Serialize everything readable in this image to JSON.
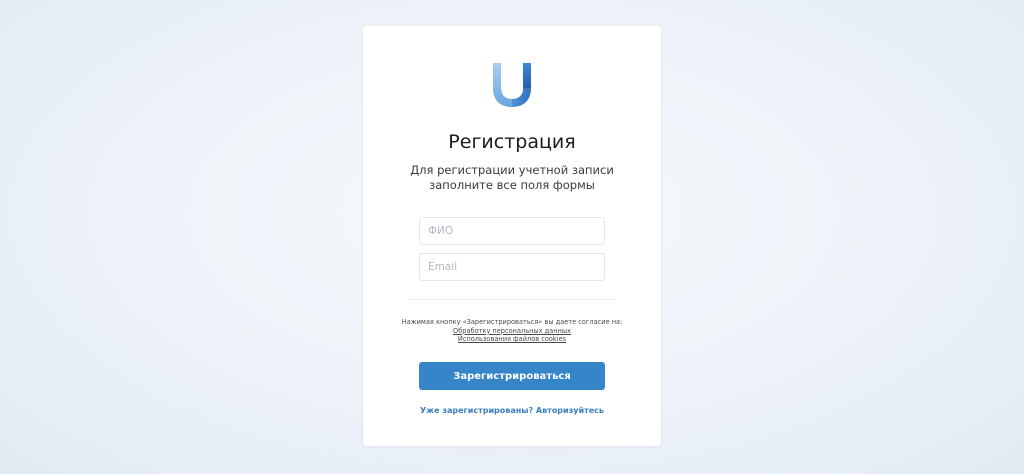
{
  "brand": {
    "logo_icon": "u-ribbon-logo",
    "accent_color": "#3585c8",
    "link_color": "#3a7fc4"
  },
  "form": {
    "title": "Регистрация",
    "subtitle_line1": "Для регистрации учетной записи",
    "subtitle_line2": "заполните все поля формы",
    "fio_placeholder": "ФИО",
    "email_placeholder": "Email",
    "consent_text": "Нажимая кнопку «Зарегистрироваться» вы даете согласие на:",
    "consent_link_personal_data": "Обработку персональных данных",
    "consent_link_cookies": "Использования файлов cookies",
    "submit_label": "Зарегистрироваться",
    "login_link_label": "Уже зарегистрированы? Авторизуйтесь"
  }
}
